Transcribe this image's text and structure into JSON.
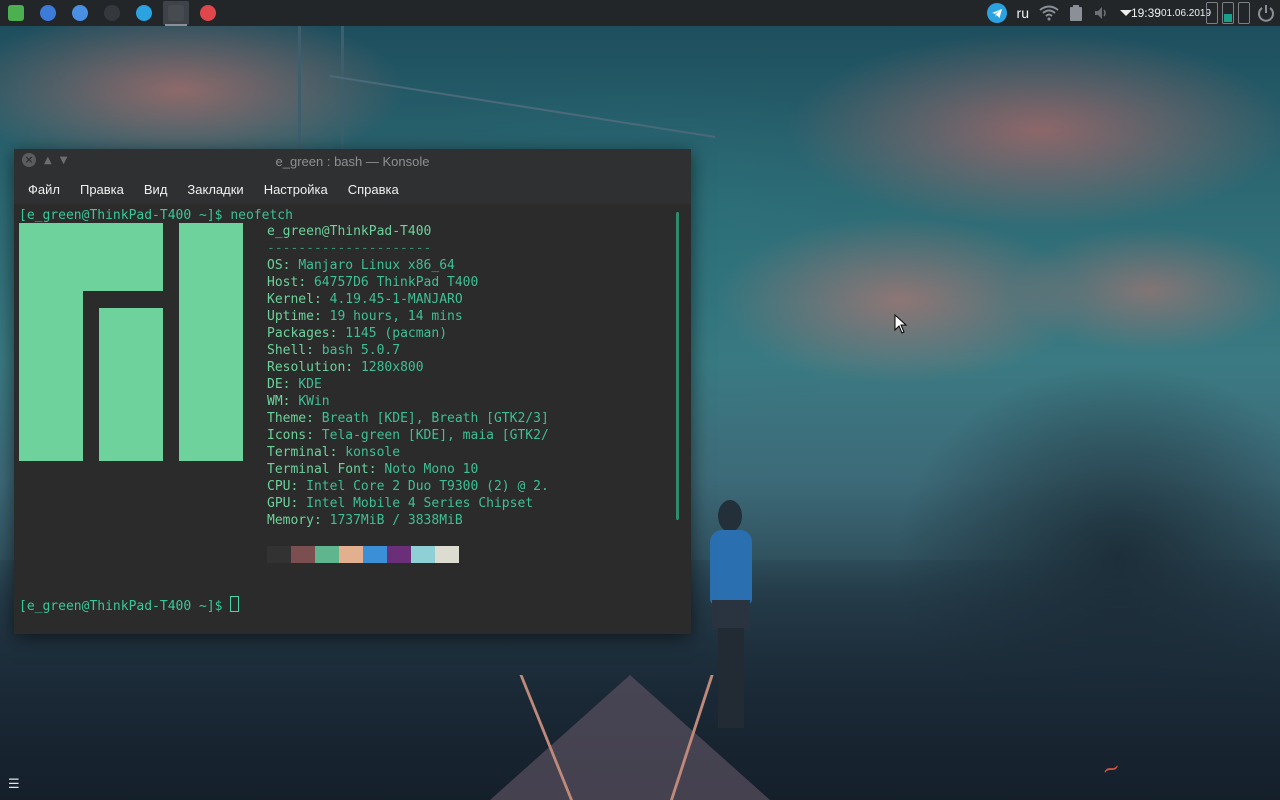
{
  "panel": {
    "apps": [
      {
        "name": "office-app",
        "icon": "spreadsheet-icon",
        "color": "#4caf50",
        "glyph": ""
      },
      {
        "name": "browser-app",
        "icon": "globe-icon",
        "color": "#3d7bd9",
        "glyph": ""
      },
      {
        "name": "chromium-app",
        "icon": "chromium-icon",
        "color": "#4a90e2",
        "glyph": ""
      },
      {
        "name": "steam-app",
        "icon": "steam-icon",
        "color": "#35393d",
        "glyph": ""
      },
      {
        "name": "telegram-app",
        "icon": "telegram-icon",
        "color": "#2aa3e0",
        "glyph": ""
      },
      {
        "name": "konsole-app",
        "icon": "terminal-icon",
        "color": "#474b50",
        "glyph": ""
      },
      {
        "name": "music-app",
        "icon": "headphones-icon",
        "color": "#e0474c",
        "glyph": ""
      }
    ],
    "active_app_index": 5,
    "tray": {
      "language": "ru",
      "time": "19:39",
      "date": "01.06.2019"
    }
  },
  "window": {
    "title": "e_green : bash — Konsole",
    "menu": [
      "Файл",
      "Правка",
      "Вид",
      "Закладки",
      "Настройка",
      "Справка"
    ]
  },
  "terminal": {
    "prompt1": "[e_green@ThinkPad-T400 ~]$ ",
    "command1": "neofetch",
    "userhost": "e_green@ThinkPad-T400",
    "separator": "---------------------",
    "info": [
      {
        "key": "OS",
        "value": "Manjaro Linux x86_64"
      },
      {
        "key": "Host",
        "value": "64757D6 ThinkPad T400"
      },
      {
        "key": "Kernel",
        "value": "4.19.45-1-MANJARO"
      },
      {
        "key": "Uptime",
        "value": "19 hours, 14 mins"
      },
      {
        "key": "Packages",
        "value": "1145 (pacman)"
      },
      {
        "key": "Shell",
        "value": "bash 5.0.7"
      },
      {
        "key": "Resolution",
        "value": "1280x800"
      },
      {
        "key": "DE",
        "value": "KDE"
      },
      {
        "key": "WM",
        "value": "KWin"
      },
      {
        "key": "Theme",
        "value": "Breath [KDE], Breath [GTK2/3]"
      },
      {
        "key": "Icons",
        "value": "Tela-green [KDE], maia [GTK2/"
      },
      {
        "key": "Terminal",
        "value": "konsole"
      },
      {
        "key": "Terminal Font",
        "value": "Noto Mono 10"
      },
      {
        "key": "CPU",
        "value": "Intel Core 2 Duo T9300 (2) @ 2."
      },
      {
        "key": "GPU",
        "value": "Intel Mobile 4 Series Chipset"
      },
      {
        "key": "Memory",
        "value": "1737MiB / 3838MiB"
      }
    ],
    "palette": [
      "#323232",
      "#7b4f4f",
      "#5fb68e",
      "#e3b08f",
      "#3a8fd6",
      "#6b2f7a",
      "#8fcfd6",
      "#dcdcd0"
    ],
    "prompt2": "[e_green@ThinkPad-T400 ~]$ "
  },
  "colors": {
    "accent": "#6dd29b",
    "panel_bg": "#232629",
    "terminal_bg": "#2b2b2b"
  }
}
